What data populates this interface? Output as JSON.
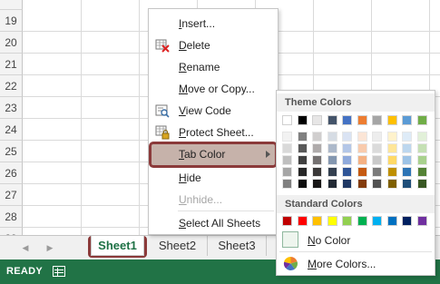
{
  "rows": [
    "19",
    "20",
    "21",
    "22",
    "23",
    "24",
    "25",
    "26",
    "27",
    "28",
    "29",
    "30"
  ],
  "context_menu": {
    "items": [
      {
        "name": "insert",
        "pre": "",
        "ul": "I",
        "post": "nsert...",
        "disabled": false,
        "icon": ""
      },
      {
        "name": "delete",
        "pre": "",
        "ul": "D",
        "post": "elete",
        "disabled": false,
        "icon": "delete-sheet-icon"
      },
      {
        "name": "rename",
        "pre": "",
        "ul": "R",
        "post": "ename",
        "disabled": false,
        "icon": ""
      },
      {
        "name": "move-or-copy",
        "pre": "",
        "ul": "M",
        "post": "ove or Copy...",
        "disabled": false,
        "icon": ""
      },
      {
        "name": "view-code",
        "pre": "",
        "ul": "V",
        "post": "iew Code",
        "disabled": false,
        "icon": "view-code-icon"
      },
      {
        "name": "protect-sheet",
        "pre": "",
        "ul": "P",
        "post": "rotect Sheet...",
        "disabled": false,
        "icon": "protect-sheet-icon"
      },
      {
        "name": "tab-color",
        "pre": "",
        "ul": "T",
        "post": "ab Color",
        "disabled": false,
        "icon": "",
        "submenu": true
      },
      {
        "name": "hide",
        "pre": "",
        "ul": "H",
        "post": "ide",
        "disabled": false,
        "icon": ""
      },
      {
        "name": "unhide",
        "pre": "",
        "ul": "U",
        "post": "nhide...",
        "disabled": true,
        "icon": ""
      },
      {
        "name": "select-all-sheets",
        "pre": "",
        "ul": "S",
        "post": "elect All Sheets",
        "disabled": false,
        "icon": ""
      }
    ]
  },
  "palette": {
    "theme_header": "Theme Colors",
    "standard_header": "Standard Colors",
    "no_color": {
      "ul": "N",
      "post": "o Color"
    },
    "more_colors": {
      "ul": "M",
      "post": "ore Colors..."
    },
    "theme_top": [
      "#ffffff",
      "#000000",
      "#e7e6e6",
      "#44546a",
      "#4472c4",
      "#ed7d31",
      "#a5a5a5",
      "#ffc000",
      "#5b9bd5",
      "#70ad47"
    ],
    "theme_shades": [
      [
        "#f2f2f2",
        "#d9d9d9",
        "#bfbfbf",
        "#a6a6a6",
        "#808080"
      ],
      [
        "#808080",
        "#595959",
        "#404040",
        "#262626",
        "#0d0d0d"
      ],
      [
        "#d0cece",
        "#afabab",
        "#757171",
        "#3a3838",
        "#171616"
      ],
      [
        "#d6dce4",
        "#adb9ca",
        "#8497b0",
        "#333f4f",
        "#222a35"
      ],
      [
        "#dae3f3",
        "#b4c7e7",
        "#8faadc",
        "#2f5597",
        "#203864"
      ],
      [
        "#fbe5d6",
        "#f8cbad",
        "#f4b183",
        "#c55a11",
        "#843c0c"
      ],
      [
        "#ededed",
        "#dbdbdb",
        "#c9c9c9",
        "#7b7b7b",
        "#525252"
      ],
      [
        "#fff2cc",
        "#ffe699",
        "#ffd966",
        "#bf9000",
        "#7f6000"
      ],
      [
        "#deebf7",
        "#bdd7ee",
        "#9dc3e6",
        "#2e75b6",
        "#1f4e79"
      ],
      [
        "#e2f0d9",
        "#c5e0b4",
        "#a9d18e",
        "#548235",
        "#385723"
      ]
    ],
    "standard": [
      "#c00000",
      "#ff0000",
      "#ffc000",
      "#ffff00",
      "#92d050",
      "#00b050",
      "#00b0f0",
      "#0070c0",
      "#002060",
      "#7030a0"
    ]
  },
  "sheets": [
    {
      "label": "Sheet1",
      "active": true
    },
    {
      "label": "Sheet2",
      "active": false
    },
    {
      "label": "Sheet3",
      "active": false
    }
  ],
  "status": {
    "text": "READY"
  }
}
